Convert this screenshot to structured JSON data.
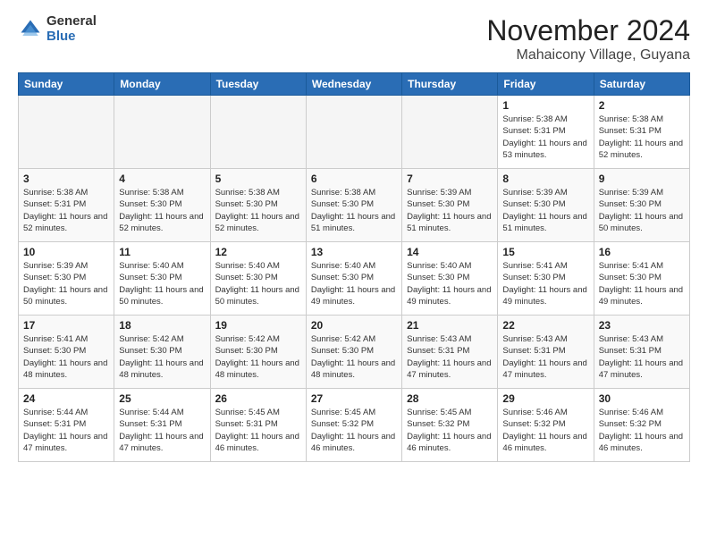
{
  "logo": {
    "general": "General",
    "blue": "Blue"
  },
  "title": {
    "month": "November 2024",
    "location": "Mahaicony Village, Guyana"
  },
  "days_of_week": [
    "Sunday",
    "Monday",
    "Tuesday",
    "Wednesday",
    "Thursday",
    "Friday",
    "Saturday"
  ],
  "weeks": [
    [
      {
        "day": "",
        "empty": true
      },
      {
        "day": "",
        "empty": true
      },
      {
        "day": "",
        "empty": true
      },
      {
        "day": "",
        "empty": true
      },
      {
        "day": "",
        "empty": true
      },
      {
        "day": "1",
        "sunrise": "5:38 AM",
        "sunset": "5:31 PM",
        "daylight": "11 hours and 53 minutes."
      },
      {
        "day": "2",
        "sunrise": "5:38 AM",
        "sunset": "5:31 PM",
        "daylight": "11 hours and 52 minutes."
      }
    ],
    [
      {
        "day": "3",
        "sunrise": "5:38 AM",
        "sunset": "5:31 PM",
        "daylight": "11 hours and 52 minutes."
      },
      {
        "day": "4",
        "sunrise": "5:38 AM",
        "sunset": "5:30 PM",
        "daylight": "11 hours and 52 minutes."
      },
      {
        "day": "5",
        "sunrise": "5:38 AM",
        "sunset": "5:30 PM",
        "daylight": "11 hours and 52 minutes."
      },
      {
        "day": "6",
        "sunrise": "5:38 AM",
        "sunset": "5:30 PM",
        "daylight": "11 hours and 51 minutes."
      },
      {
        "day": "7",
        "sunrise": "5:39 AM",
        "sunset": "5:30 PM",
        "daylight": "11 hours and 51 minutes."
      },
      {
        "day": "8",
        "sunrise": "5:39 AM",
        "sunset": "5:30 PM",
        "daylight": "11 hours and 51 minutes."
      },
      {
        "day": "9",
        "sunrise": "5:39 AM",
        "sunset": "5:30 PM",
        "daylight": "11 hours and 50 minutes."
      }
    ],
    [
      {
        "day": "10",
        "sunrise": "5:39 AM",
        "sunset": "5:30 PM",
        "daylight": "11 hours and 50 minutes."
      },
      {
        "day": "11",
        "sunrise": "5:40 AM",
        "sunset": "5:30 PM",
        "daylight": "11 hours and 50 minutes."
      },
      {
        "day": "12",
        "sunrise": "5:40 AM",
        "sunset": "5:30 PM",
        "daylight": "11 hours and 50 minutes."
      },
      {
        "day": "13",
        "sunrise": "5:40 AM",
        "sunset": "5:30 PM",
        "daylight": "11 hours and 49 minutes."
      },
      {
        "day": "14",
        "sunrise": "5:40 AM",
        "sunset": "5:30 PM",
        "daylight": "11 hours and 49 minutes."
      },
      {
        "day": "15",
        "sunrise": "5:41 AM",
        "sunset": "5:30 PM",
        "daylight": "11 hours and 49 minutes."
      },
      {
        "day": "16",
        "sunrise": "5:41 AM",
        "sunset": "5:30 PM",
        "daylight": "11 hours and 49 minutes."
      }
    ],
    [
      {
        "day": "17",
        "sunrise": "5:41 AM",
        "sunset": "5:30 PM",
        "daylight": "11 hours and 48 minutes."
      },
      {
        "day": "18",
        "sunrise": "5:42 AM",
        "sunset": "5:30 PM",
        "daylight": "11 hours and 48 minutes."
      },
      {
        "day": "19",
        "sunrise": "5:42 AM",
        "sunset": "5:30 PM",
        "daylight": "11 hours and 48 minutes."
      },
      {
        "day": "20",
        "sunrise": "5:42 AM",
        "sunset": "5:30 PM",
        "daylight": "11 hours and 48 minutes."
      },
      {
        "day": "21",
        "sunrise": "5:43 AM",
        "sunset": "5:31 PM",
        "daylight": "11 hours and 47 minutes."
      },
      {
        "day": "22",
        "sunrise": "5:43 AM",
        "sunset": "5:31 PM",
        "daylight": "11 hours and 47 minutes."
      },
      {
        "day": "23",
        "sunrise": "5:43 AM",
        "sunset": "5:31 PM",
        "daylight": "11 hours and 47 minutes."
      }
    ],
    [
      {
        "day": "24",
        "sunrise": "5:44 AM",
        "sunset": "5:31 PM",
        "daylight": "11 hours and 47 minutes."
      },
      {
        "day": "25",
        "sunrise": "5:44 AM",
        "sunset": "5:31 PM",
        "daylight": "11 hours and 47 minutes."
      },
      {
        "day": "26",
        "sunrise": "5:45 AM",
        "sunset": "5:31 PM",
        "daylight": "11 hours and 46 minutes."
      },
      {
        "day": "27",
        "sunrise": "5:45 AM",
        "sunset": "5:32 PM",
        "daylight": "11 hours and 46 minutes."
      },
      {
        "day": "28",
        "sunrise": "5:45 AM",
        "sunset": "5:32 PM",
        "daylight": "11 hours and 46 minutes."
      },
      {
        "day": "29",
        "sunrise": "5:46 AM",
        "sunset": "5:32 PM",
        "daylight": "11 hours and 46 minutes."
      },
      {
        "day": "30",
        "sunrise": "5:46 AM",
        "sunset": "5:32 PM",
        "daylight": "11 hours and 46 minutes."
      }
    ]
  ]
}
